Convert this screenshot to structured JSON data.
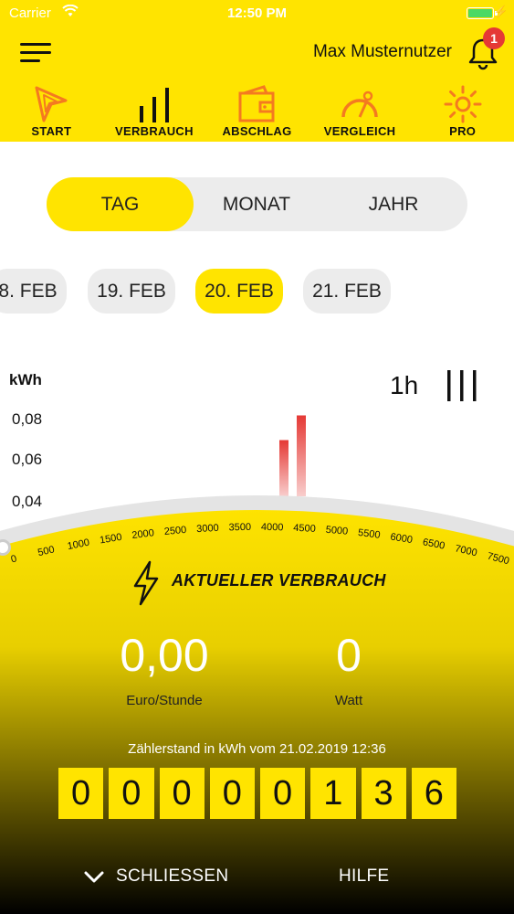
{
  "status": {
    "carrier": "Carrier",
    "time": "12:50 PM"
  },
  "header": {
    "username": "Max Musternutzer",
    "notification_count": "1"
  },
  "nav": [
    {
      "label": "START",
      "icon": "start-arrow-icon"
    },
    {
      "label": "VERBRAUCH",
      "icon": "consumption-bars-icon"
    },
    {
      "label": "ABSCHLAG",
      "icon": "wallet-icon"
    },
    {
      "label": "VERGLEICH",
      "icon": "gauge-icon"
    },
    {
      "label": "PRO",
      "icon": "sun-icon"
    }
  ],
  "segment": {
    "options": [
      "TAG",
      "MONAT",
      "JAHR"
    ],
    "selected": "TAG"
  },
  "dates": [
    "8. FEB",
    "19. FEB",
    "20. FEB",
    "21. FEB"
  ],
  "selected_date": "20. FEB",
  "chart_controls": {
    "interval": "1h"
  },
  "chart_data": {
    "type": "bar",
    "ylabel": "kWh",
    "yticks": [
      "0,08",
      "0,06",
      "0,04"
    ],
    "ylim": [
      0.03,
      0.085
    ],
    "series": [
      {
        "values": [
          0.07,
          0.082
        ]
      }
    ],
    "bar_color": "#E53935"
  },
  "gauge": {
    "title": "AKTUELLER VERBRAUCH",
    "ticks": [
      "0",
      "500",
      "1000",
      "1500",
      "2000",
      "2500",
      "3000",
      "3500",
      "4000",
      "4500",
      "5000",
      "5500",
      "6000",
      "6500",
      "7000",
      "7500"
    ]
  },
  "readings": {
    "cost_value": "0,00",
    "cost_unit": "Euro/Stunde",
    "power_value": "0",
    "power_unit": "Watt",
    "meter_caption": "Zählerstand in kWh vom 21.02.2019 12:36",
    "meter_digits": [
      "0",
      "0",
      "0",
      "0",
      "0",
      "1",
      "3",
      "6"
    ]
  },
  "footer": {
    "close_label": "SCHLIESSEN",
    "help_label": "HILFE"
  },
  "colors": {
    "accent": "#FFE400",
    "alert": "#E53935",
    "icon_orange": "#F47A20"
  }
}
